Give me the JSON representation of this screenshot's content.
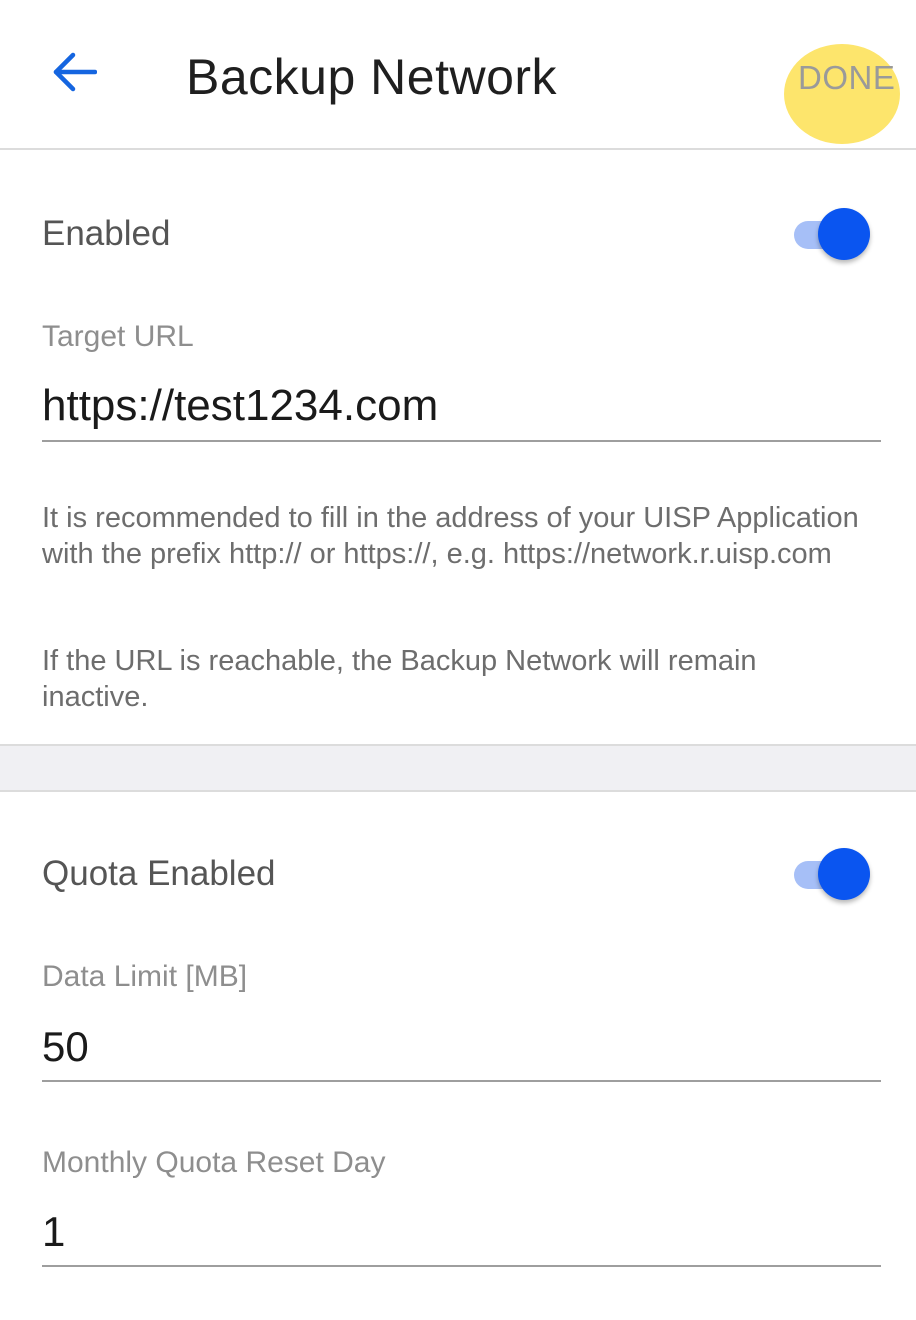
{
  "header": {
    "title": "Backup Network",
    "done_label": "DONE",
    "back_icon": "arrow-left-icon"
  },
  "backup_section": {
    "enabled_label": "Enabled",
    "enabled_state": true,
    "target_url_label": "Target URL",
    "target_url_value": "https://test1234.com",
    "helper_line1": "It is recommended to fill in the address of your UISP Application with the prefix http:// or https://, e.g. https://network.r.uisp.com",
    "helper_line2": "If the URL is reachable, the Backup Network will remain inactive."
  },
  "quota_section": {
    "quota_enabled_label": "Quota Enabled",
    "quota_enabled_state": true,
    "data_limit_label": "Data Limit [MB]",
    "data_limit_value": "50",
    "reset_day_label": "Monthly Quota Reset Day",
    "reset_day_value": "1"
  },
  "colors": {
    "accent": "#0a55f0",
    "track": "#a6bff7",
    "highlight": "#fde56c"
  }
}
